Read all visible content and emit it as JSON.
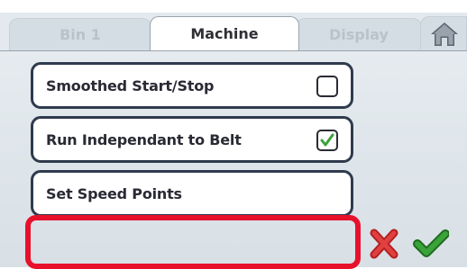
{
  "tabs": [
    {
      "label": "Bin 1",
      "active": false
    },
    {
      "label": "Machine",
      "active": true
    },
    {
      "label": "Display",
      "active": false
    }
  ],
  "home": {
    "icon": "home-icon"
  },
  "rows": [
    {
      "label": "Smoothed Start/Stop",
      "checked": false
    },
    {
      "label": "Run Independant to Belt",
      "checked": true
    },
    {
      "label": "Set Speed Points"
    }
  ],
  "actions": {
    "cancel_icon": "x-icon",
    "confirm_icon": "check-icon"
  },
  "colors": {
    "highlight": "#e8112c",
    "cancel": "#d62a2a",
    "confirm": "#2e8b2e",
    "checkmark": "#3aa33a"
  }
}
